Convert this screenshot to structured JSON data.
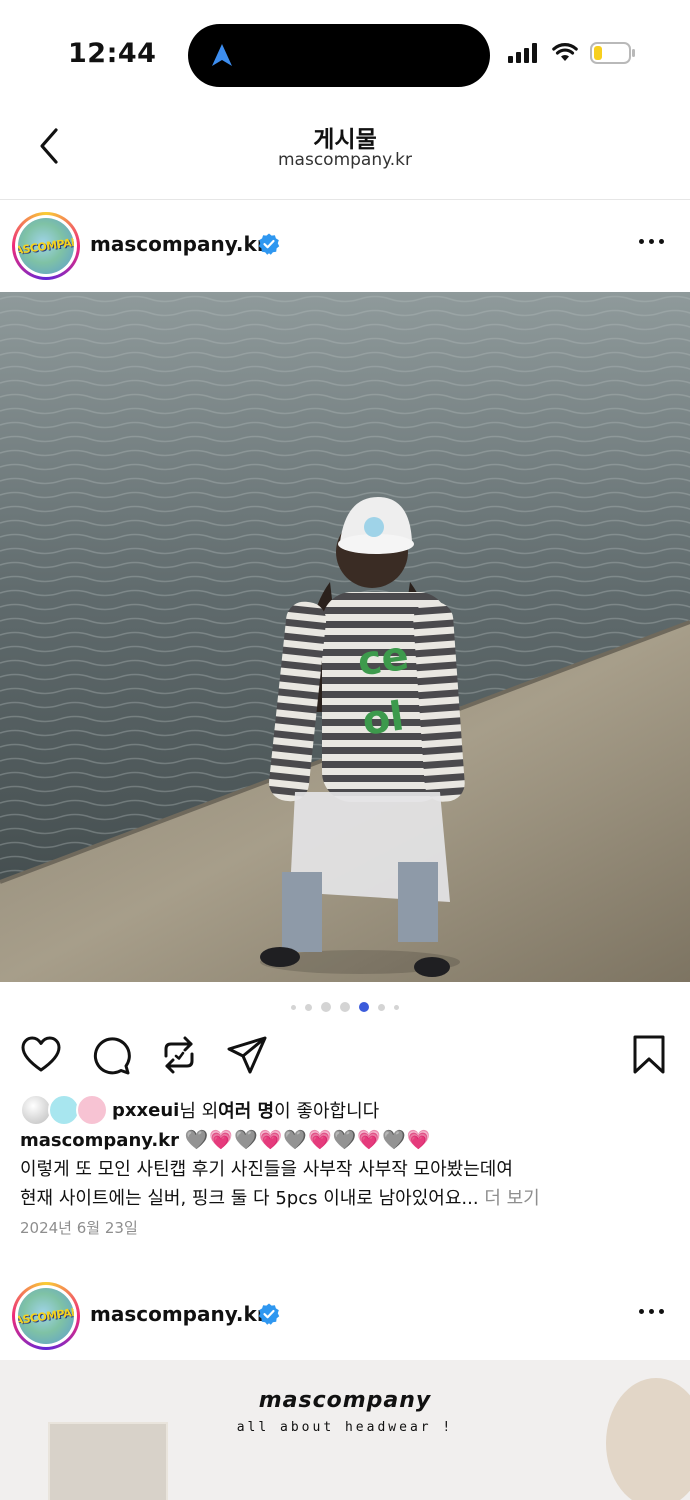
{
  "status_bar": {
    "time": "12:44"
  },
  "header": {
    "title": "게시물",
    "subtitle": "mascompany.kr"
  },
  "post": {
    "username": "mascompany.kr",
    "avatar_text": "MASCOMPANY",
    "carousel": {
      "total": 7,
      "active_index": 4
    },
    "likes": {
      "liker": "pxxeui",
      "text_mid": "님 외 ",
      "others": "여러 명",
      "text_end": "이 좋아합니다"
    },
    "caption": {
      "username": "mascompany.kr",
      "emoji": "🩶💗🩶💗🩶💗🩶💗🩶💗",
      "line1": "이렇게 또 모인 사틴캡 후기 사진들을 사부작 사부작 모아봤는데여",
      "line2": "현재 사이트에는 실버, 핑크 둘 다 5pcs 이내로 남아있어요...",
      "more_label": "더 보기"
    },
    "date": "2024년 6월 23일"
  },
  "next_post": {
    "username": "mascompany.kr",
    "avatar_text": "MASCOMPANY",
    "brand": "mascompany",
    "tagline": "all about headwear !"
  }
}
